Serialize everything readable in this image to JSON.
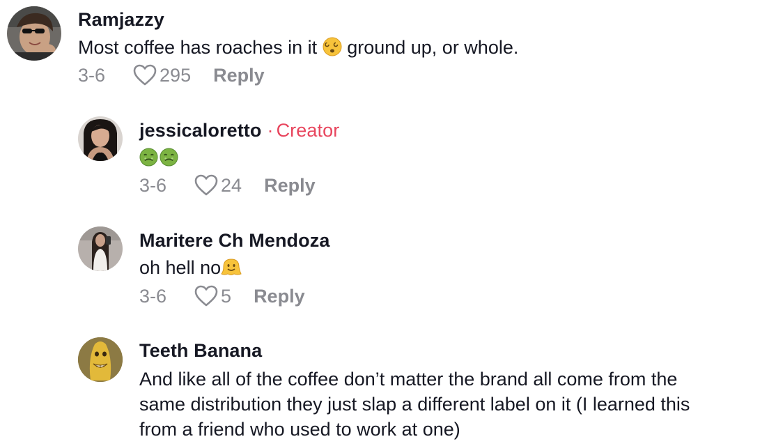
{
  "comments": [
    {
      "username": "Ramjazzy",
      "text_before": "Most coffee has roaches in it ",
      "text_emoji": "dizzy-face",
      "text_after": " ground up, or whole.",
      "date": "3-6",
      "likes": "295",
      "reply_label": "Reply"
    },
    {
      "username": "jessicaloretto",
      "creator_separator": "·",
      "creator_label": "Creator",
      "text_emoji": "nauseated-face x2",
      "date": "3-6",
      "likes": "24",
      "reply_label": "Reply"
    },
    {
      "username": "Maritere Ch Mendoza",
      "text_before": "oh hell no",
      "text_emoji": "melting-face",
      "date": "3-6",
      "likes": "5",
      "reply_label": "Reply"
    },
    {
      "username": "Teeth Banana",
      "text_line1": "And like all of the coffee don’t matter the brand all come from the",
      "text_line2": "same distribution they just slap a different label on it (I learned this",
      "text_line3": "from a friend who used to work at one)"
    }
  ],
  "colors": {
    "username": "#161823",
    "meta": "#8a8b91",
    "creator": "#e8465e"
  }
}
